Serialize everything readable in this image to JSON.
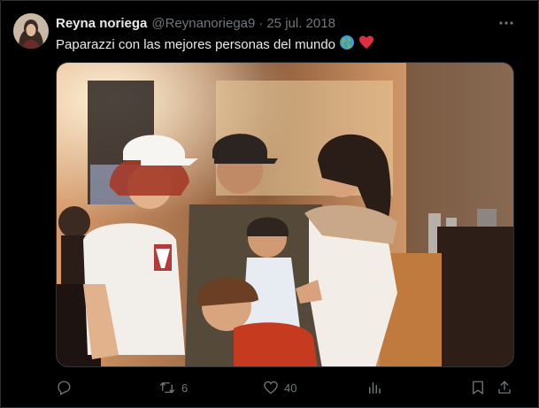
{
  "tweet": {
    "author_name": "Reyna noriega",
    "handle": "@Reynanoriega9",
    "separator": "·",
    "date": "25 jul. 2018",
    "text": "Paparazzi con las mejores personas del mundo",
    "emojis": [
      "globe-icon",
      "red-heart-icon"
    ],
    "media": {
      "type": "photo",
      "shirt_logo": "reebok"
    },
    "actions": {
      "reply_count": "",
      "retweet_count": "6",
      "like_count": "40",
      "views_count": ""
    }
  },
  "colors": {
    "background": "#000000",
    "primary_text": "#e7e9ea",
    "secondary_text": "#71767b",
    "border": "#2f3336",
    "heart": "#f91880"
  }
}
